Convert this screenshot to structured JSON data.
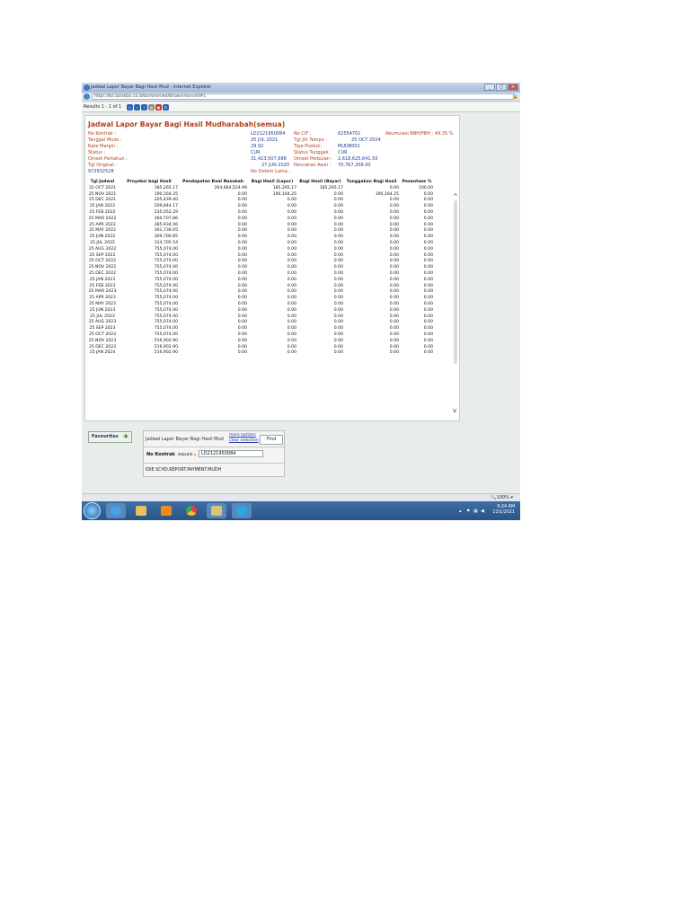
{
  "window": {
    "title": "Jadwal Lapor Bayar Bagi Hasil Mud - Internet Explorer",
    "url": "https://bsi.bankbsi.co.id/bsm/servlet/BrowserServlet#1"
  },
  "results_label": "Results 1 - 1 of 1",
  "report": {
    "title": "Jadwal Lapor Bayar Bagi Hasil Mudharabah(semua)",
    "fields_left": [
      {
        "label": "No Kontrak :",
        "value": "LD2121950084"
      },
      {
        "label": "Tanggal Mulai :",
        "value": "25 JUL 2021"
      },
      {
        "label": "Rate Margin :",
        "value": "29.92"
      },
      {
        "label": "Status :",
        "value": "CUR"
      },
      {
        "label": "Omset Pertahun :",
        "value": "31,423,507,698"
      },
      {
        "label": "Tgl Original :",
        "value": "27 JUN 2020"
      }
    ],
    "fields_mid": [
      {
        "label": "No CIF :",
        "value": "62554701"
      },
      {
        "label": "Tgl Jth Tempo :",
        "value": "25 OCT 2024"
      },
      {
        "label": "Tipe Produk:",
        "value": "MUDB001"
      },
      {
        "label": "Status Tunggak :",
        "value": "CUR"
      },
      {
        "label": "Omset Perbulan :",
        "value": "2,618,625,641.50"
      },
      {
        "label": "Pencairan Awal :",
        "value": "70,767,308.00"
      }
    ],
    "akumulasi": "Akumulasi RBH/PBH : 49.35 %",
    "no_sistem_lama": "No Sistem Lama :",
    "original_no": "972932528"
  },
  "table": {
    "headers": [
      "Tgl Jadwal",
      "Proyeksi bagi Hasil",
      "Pendapatan Real Nasabah",
      "Bagi Hasil (Lapor)",
      "Bagi Hasil (Bayar)",
      "Tunggakan Bagi Hasil",
      "Pesentase %"
    ],
    "rows": [
      [
        "31 OCT 2021",
        "185,265.17",
        "264,664,524.99",
        "185,265.17",
        "185,265.17",
        "0.00",
        "100.00"
      ],
      [
        "25 NOV 2021",
        "190,164.25",
        "0.00",
        "190,164.25",
        "0.00",
        "190,164.25",
        "0.00"
      ],
      [
        "25 DEC 2021",
        "205,439.40",
        "0.00",
        "0.00",
        "0.00",
        "0.00",
        "0.00"
      ],
      [
        "25 JAN 2022",
        "209,844.17",
        "0.00",
        "0.00",
        "0.00",
        "0.00",
        "0.00"
      ],
      [
        "25 FEB 2022",
        "235,052.29",
        "0.00",
        "0.00",
        "0.00",
        "0.00",
        "0.00"
      ],
      [
        "25 MAR 2022",
        "260,707.86",
        "0.00",
        "0.00",
        "0.00",
        "0.00",
        "0.00"
      ],
      [
        "25 APR 2022",
        "285,934.46",
        "0.00",
        "0.00",
        "0.00",
        "0.00",
        "0.00"
      ],
      [
        "25 MAY 2022",
        "301,736.05",
        "0.00",
        "0.00",
        "0.00",
        "0.00",
        "0.00"
      ],
      [
        "25 JUN 2022",
        "309,706.85",
        "0.00",
        "0.00",
        "0.00",
        "0.00",
        "0.00"
      ],
      [
        "25 JUL 2022",
        "314,705.54",
        "0.00",
        "0.00",
        "0.00",
        "0.00",
        "0.00"
      ],
      [
        "25 AUG 2022",
        "755,074.00",
        "0.00",
        "0.00",
        "0.00",
        "0.00",
        "0.00"
      ],
      [
        "25 SEP 2022",
        "755,074.00",
        "0.00",
        "0.00",
        "0.00",
        "0.00",
        "0.00"
      ],
      [
        "25 OCT 2022",
        "755,074.00",
        "0.00",
        "0.00",
        "0.00",
        "0.00",
        "0.00"
      ],
      [
        "25 NOV 2022",
        "755,074.00",
        "0.00",
        "0.00",
        "0.00",
        "0.00",
        "0.00"
      ],
      [
        "25 DEC 2022",
        "755,074.00",
        "0.00",
        "0.00",
        "0.00",
        "0.00",
        "0.00"
      ],
      [
        "25 JAN 2023",
        "755,074.00",
        "0.00",
        "0.00",
        "0.00",
        "0.00",
        "0.00"
      ],
      [
        "25 FEB 2023",
        "755,074.00",
        "0.00",
        "0.00",
        "0.00",
        "0.00",
        "0.00"
      ],
      [
        "25 MAR 2023",
        "755,074.00",
        "0.00",
        "0.00",
        "0.00",
        "0.00",
        "0.00"
      ],
      [
        "25 APR 2023",
        "755,074.00",
        "0.00",
        "0.00",
        "0.00",
        "0.00",
        "0.00"
      ],
      [
        "25 MAY 2023",
        "755,074.00",
        "0.00",
        "0.00",
        "0.00",
        "0.00",
        "0.00"
      ],
      [
        "25 JUN 2023",
        "755,074.00",
        "0.00",
        "0.00",
        "0.00",
        "0.00",
        "0.00"
      ],
      [
        "25 JUL 2023",
        "755,074.00",
        "0.00",
        "0.00",
        "0.00",
        "0.00",
        "0.00"
      ],
      [
        "25 AUG 2023",
        "755,074.00",
        "0.00",
        "0.00",
        "0.00",
        "0.00",
        "0.00"
      ],
      [
        "25 SEP 2023",
        "755,074.00",
        "0.00",
        "0.00",
        "0.00",
        "0.00",
        "0.00"
      ],
      [
        "25 OCT 2023",
        "755,074.00",
        "0.00",
        "0.00",
        "0.00",
        "0.00",
        "0.00"
      ],
      [
        "25 NOV 2023",
        "516,902.90",
        "0.00",
        "0.00",
        "0.00",
        "0.00",
        "0.00"
      ],
      [
        "25 DEC 2023",
        "516,902.90",
        "0.00",
        "0.00",
        "0.00",
        "0.00",
        "0.00"
      ],
      [
        "25 JAN 2024",
        "516,902.90",
        "0.00",
        "0.00",
        "0.00",
        "0.00",
        "0.00"
      ]
    ]
  },
  "favourites_label": "Favourites",
  "search": {
    "query_name": "Jadwal Lapor Bayar Bagi Hasil Mud",
    "more_options": "more options",
    "clear_selection": "clear selection",
    "find_label": "Find",
    "field_label": "No Kontrak",
    "operator": "equals",
    "field_value": "LD2121950084",
    "report_id": "IDIE.SCHD.REPORT.PAYMENT.MUDH"
  },
  "statusbar": {
    "zoom": "100%"
  },
  "taskbar": {
    "time": "9:24 AM",
    "date": "12/1/2021",
    "apps": [
      "windows-explorer",
      "internet-explorer",
      "file-explorer",
      "media-player",
      "chrome",
      "t24-app",
      "skype"
    ]
  }
}
